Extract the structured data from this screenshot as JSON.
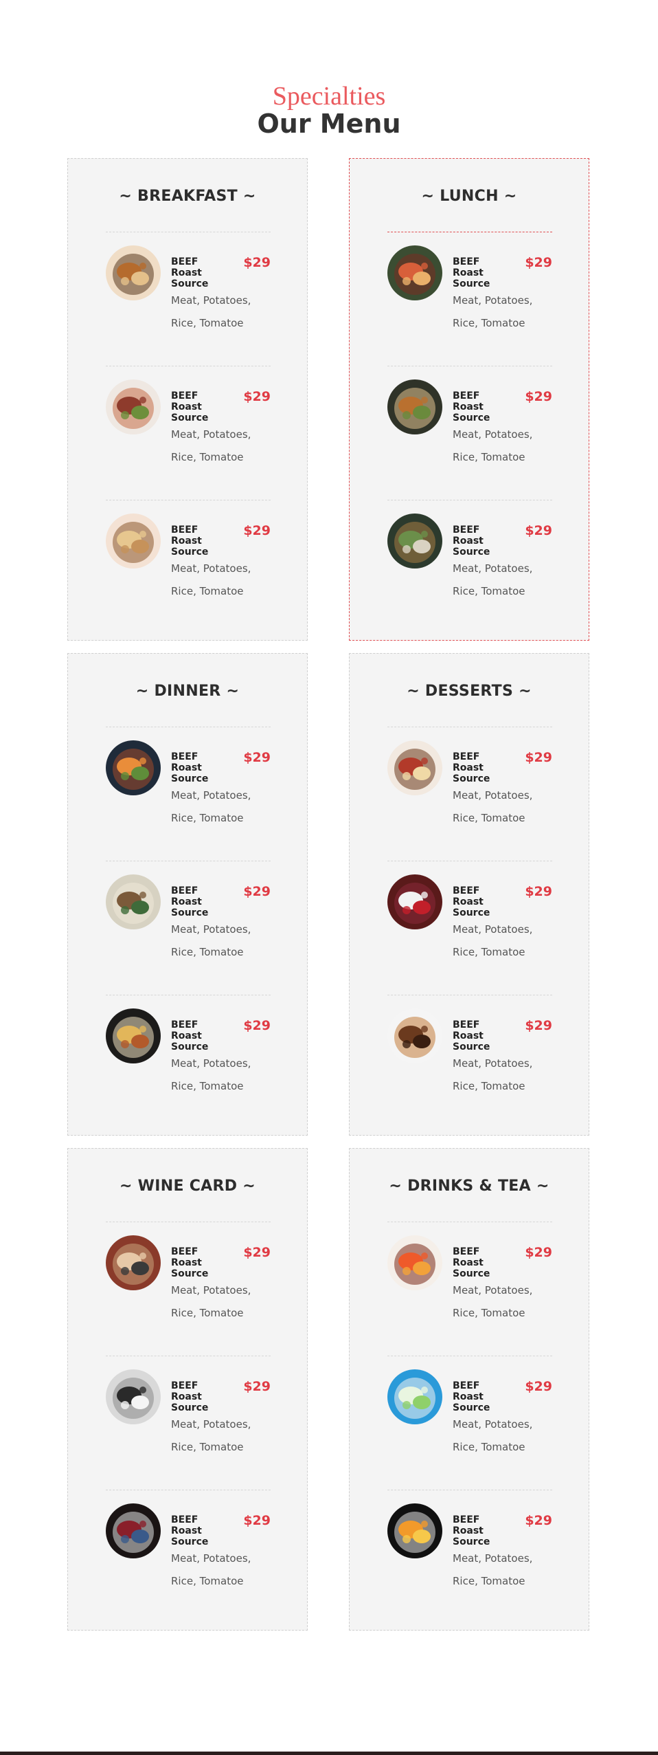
{
  "header": {
    "subtitle": "Specialties",
    "title": "Our Menu"
  },
  "cards": [
    {
      "title": "~ BREAKFAST ~",
      "items": [
        {
          "name": "BEEF Roast Source",
          "price": "$29",
          "desc": "Meat, Potatoes, Rice, Tomatoe",
          "icon": "noodle-dish-image"
        },
        {
          "name": "BEEF Roast Source",
          "price": "$29",
          "desc": "Meat, Potatoes, Rice, Tomatoe",
          "icon": "salad-bowl-image"
        },
        {
          "name": "BEEF Roast Source",
          "price": "$29",
          "desc": "Meat, Potatoes, Rice, Tomatoe",
          "icon": "pasta-plate-image"
        }
      ]
    },
    {
      "title": "~ LUNCH ~",
      "items": [
        {
          "name": "BEEF Roast Source",
          "price": "$29",
          "desc": "Meat, Potatoes, Rice, Tomatoe",
          "icon": "salmon-dish-image"
        },
        {
          "name": "BEEF Roast Source",
          "price": "$29",
          "desc": "Meat, Potatoes, Rice, Tomatoe",
          "icon": "grilled-chicken-image"
        },
        {
          "name": "BEEF Roast Source",
          "price": "$29",
          "desc": "Meat, Potatoes, Rice, Tomatoe",
          "icon": "herb-plate-image"
        }
      ]
    },
    {
      "title": "~ DINNER ~",
      "items": [
        {
          "name": "BEEF Roast Source",
          "price": "$29",
          "desc": "Meat, Potatoes, Rice, Tomatoe",
          "icon": "steak-bowl-image"
        },
        {
          "name": "BEEF Roast Source",
          "price": "$29",
          "desc": "Meat, Potatoes, Rice, Tomatoe",
          "icon": "soup-bowl-image"
        },
        {
          "name": "BEEF Roast Source",
          "price": "$29",
          "desc": "Meat, Potatoes, Rice, Tomatoe",
          "icon": "rice-plate-image"
        }
      ]
    },
    {
      "title": "~ DESSERTS ~",
      "items": [
        {
          "name": "BEEF Roast Source",
          "price": "$29",
          "desc": "Meat, Potatoes, Rice, Tomatoe",
          "icon": "pancake-stack-image"
        },
        {
          "name": "BEEF Roast Source",
          "price": "$29",
          "desc": "Meat, Potatoes, Rice, Tomatoe",
          "icon": "parfait-glasses-image"
        },
        {
          "name": "BEEF Roast Source",
          "price": "$29",
          "desc": "Meat, Potatoes, Rice, Tomatoe",
          "icon": "lava-cake-image"
        }
      ]
    },
    {
      "title": "~ WINE CARD ~",
      "items": [
        {
          "name": "BEEF Roast Source",
          "price": "$29",
          "desc": "Meat, Potatoes, Rice, Tomatoe",
          "icon": "wine-pour-image"
        },
        {
          "name": "BEEF Roast Source",
          "price": "$29",
          "desc": "Meat, Potatoes, Rice, Tomatoe",
          "icon": "bottle-rack-image"
        },
        {
          "name": "BEEF Roast Source",
          "price": "$29",
          "desc": "Meat, Potatoes, Rice, Tomatoe",
          "icon": "red-wine-image"
        }
      ]
    },
    {
      "title": "~ DRINKS & TEA ~",
      "items": [
        {
          "name": "BEEF Roast Source",
          "price": "$29",
          "desc": "Meat, Potatoes, Rice, Tomatoe",
          "icon": "orange-drinks-image"
        },
        {
          "name": "BEEF Roast Source",
          "price": "$29",
          "desc": "Meat, Potatoes, Rice, Tomatoe",
          "icon": "mojito-image"
        },
        {
          "name": "BEEF Roast Source",
          "price": "$29",
          "desc": "Meat, Potatoes, Rice, Tomatoe",
          "icon": "orange-cocktail-image"
        }
      ]
    }
  ],
  "colors": {
    "accent": "#e03b44",
    "subtitle": "#ea5a5e",
    "card_bg": "#f4f4f4",
    "active_border": "#e04e52"
  }
}
